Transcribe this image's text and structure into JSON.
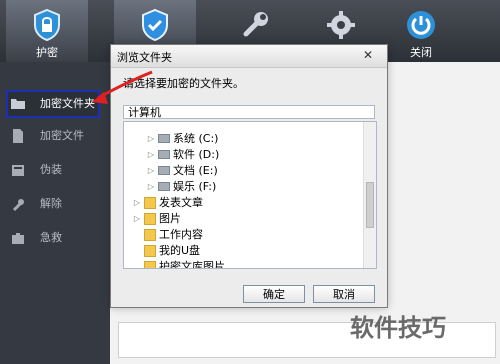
{
  "toolbar": {
    "tools": [
      {
        "label": "护密",
        "icon": "shield-lock-icon"
      },
      {
        "label": "",
        "icon": "shield-check-icon"
      },
      {
        "label": "",
        "icon": "wrench-icon"
      },
      {
        "label": "",
        "icon": "gear-icon"
      },
      {
        "label": "关闭",
        "icon": "power-icon"
      }
    ]
  },
  "sidebar": {
    "items": [
      {
        "label": "加密文件夹",
        "icon": "folder-open-icon",
        "selected": true
      },
      {
        "label": "加密文件",
        "icon": "file-icon"
      },
      {
        "label": "伪装",
        "icon": "disguise-icon"
      },
      {
        "label": "解除",
        "icon": "tool-icon"
      },
      {
        "label": "急救",
        "icon": "briefcase-icon"
      }
    ]
  },
  "dialog": {
    "title": "浏览文件夹",
    "close": "✕",
    "prompt": "请选择要加密的文件夹。",
    "path_value": "计算机",
    "tree": [
      {
        "label": "系统 (C:)",
        "type": "drive"
      },
      {
        "label": "软件 (D:)",
        "type": "drive"
      },
      {
        "label": "文档 (E:)",
        "type": "drive"
      },
      {
        "label": "娱乐 (F:)",
        "type": "drive"
      },
      {
        "label": "发表文章",
        "type": "folder"
      },
      {
        "label": "图片",
        "type": "folder"
      },
      {
        "label": "工作内容",
        "type": "folder"
      },
      {
        "label": "我的U盘",
        "type": "folder"
      },
      {
        "label": "护密文库图片",
        "type": "folder"
      }
    ],
    "ok_label": "确定",
    "cancel_label": "取消"
  },
  "watermark": "软件技巧",
  "colors": {
    "highlight": "#1b2fb4",
    "arrow": "#e02020"
  }
}
